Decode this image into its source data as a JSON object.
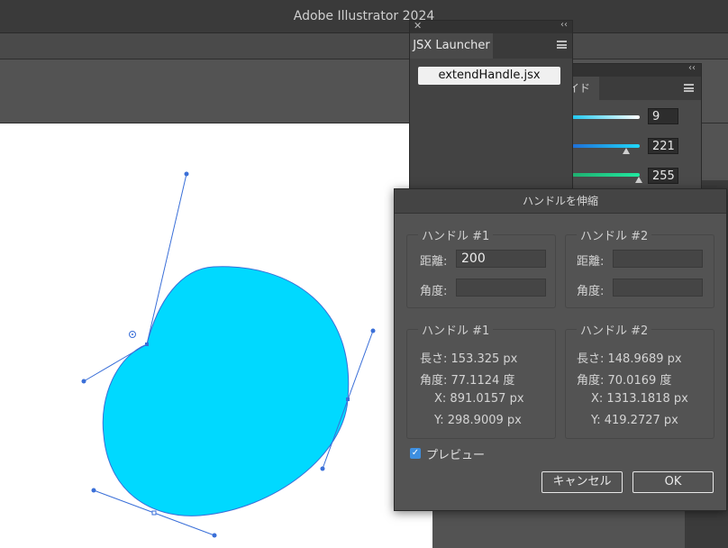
{
  "app": {
    "title": "Adobe Illustrator 2024"
  },
  "jsx_panel": {
    "tab": "JSX Launcher",
    "script_button": "extendHandle.jsx"
  },
  "color_panel": {
    "tab_partial": "イド",
    "values": [
      "9",
      "221",
      "255"
    ],
    "slider_colors": [
      "#20c8f0",
      "#1f8ee0",
      "#1fd88a"
    ]
  },
  "dialog": {
    "title": "ハンドルを伸縮",
    "input_group_1": {
      "title": "ハンドル #1",
      "distance_label": "距離:",
      "distance_value": "200",
      "angle_label": "角度:",
      "angle_value": ""
    },
    "input_group_2": {
      "title": "ハンドル #2",
      "distance_label": "距離:",
      "distance_value": "",
      "angle_label": "角度:",
      "angle_value": ""
    },
    "info_group_1": {
      "title": "ハンドル #1",
      "length": "長さ: 153.325 px",
      "angle": "角度: 77.1124 度",
      "x": "X: 891.0157 px",
      "y": "Y: 298.9009 px"
    },
    "info_group_2": {
      "title": "ハンドル #2",
      "length": "長さ: 148.9689 px",
      "angle": "角度: 70.0169 度",
      "x": "X: 1313.1818 px",
      "y": "Y: 419.2727 px"
    },
    "preview_label": "プレビュー",
    "preview_checked": true,
    "cancel_label": "キャンセル",
    "ok_label": "OK"
  },
  "colors": {
    "shape_fill": "#00d9ff",
    "path_stroke": "#3a6fd8",
    "canvas": "#ffffff"
  }
}
